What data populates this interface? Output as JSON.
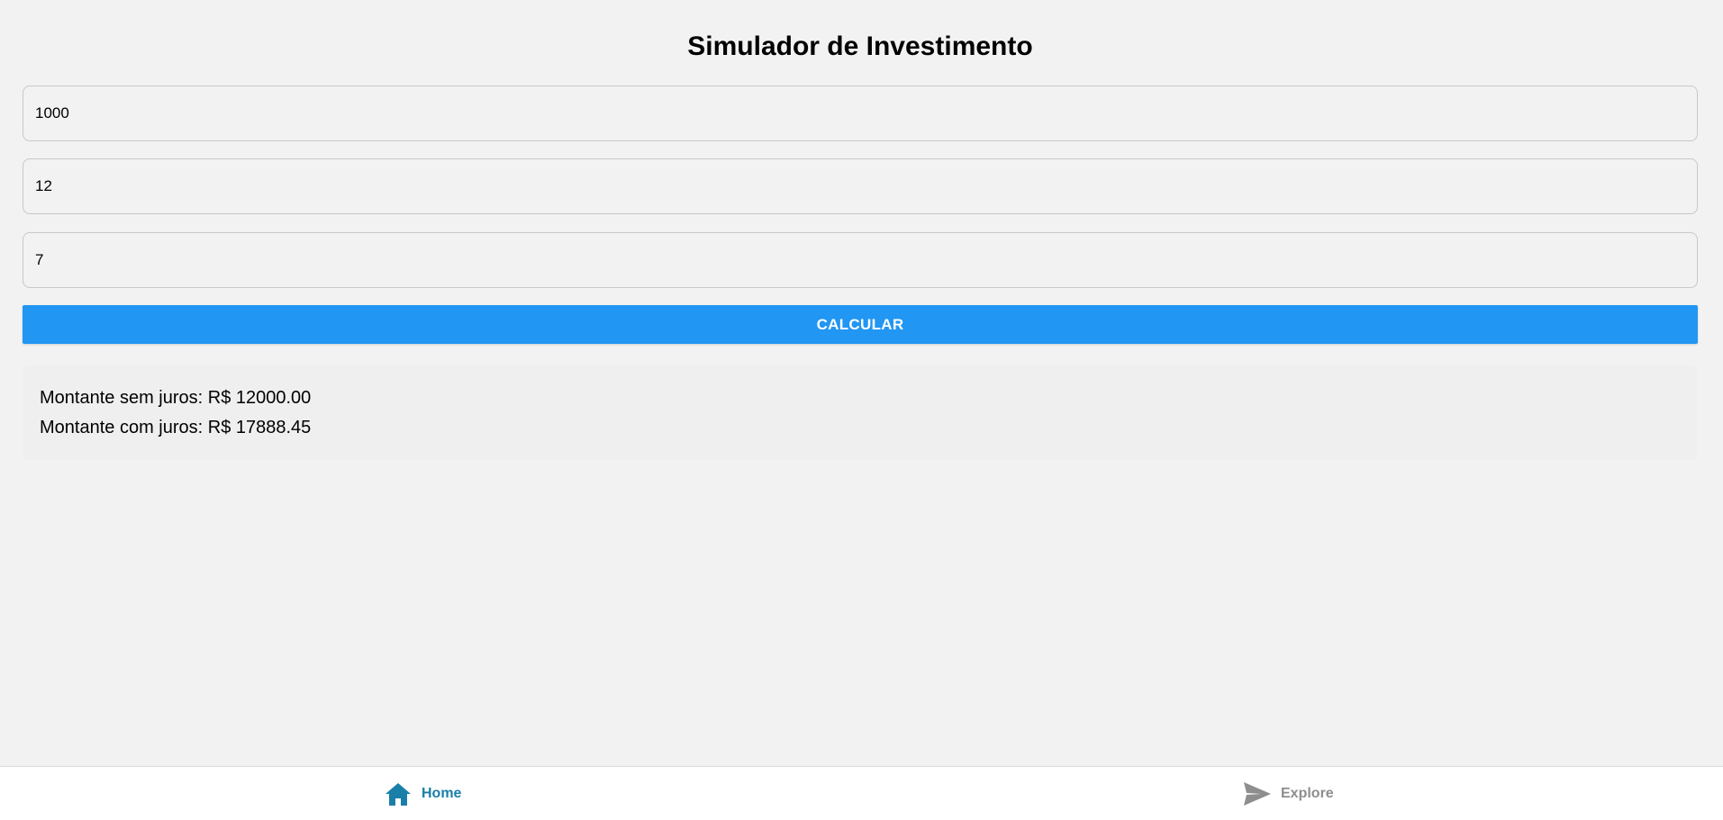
{
  "page": {
    "title": "Simulador de Investimento"
  },
  "form": {
    "fields": [
      {
        "value": "1000"
      },
      {
        "value": "12"
      },
      {
        "value": "7"
      }
    ],
    "calculate_label": "CALCULAR"
  },
  "results": {
    "line1": "Montante sem juros: R$ 12000.00",
    "line2": "Montante com juros: R$ 17888.45"
  },
  "tabbar": {
    "home": {
      "label": "Home",
      "icon": "home-icon",
      "active": true,
      "color": "#1a7fa8"
    },
    "explore": {
      "label": "Explore",
      "icon": "send-icon",
      "active": false,
      "color": "#8e8e8e"
    }
  },
  "colors": {
    "accent": "#2196f3",
    "background": "#f2f2f2"
  }
}
